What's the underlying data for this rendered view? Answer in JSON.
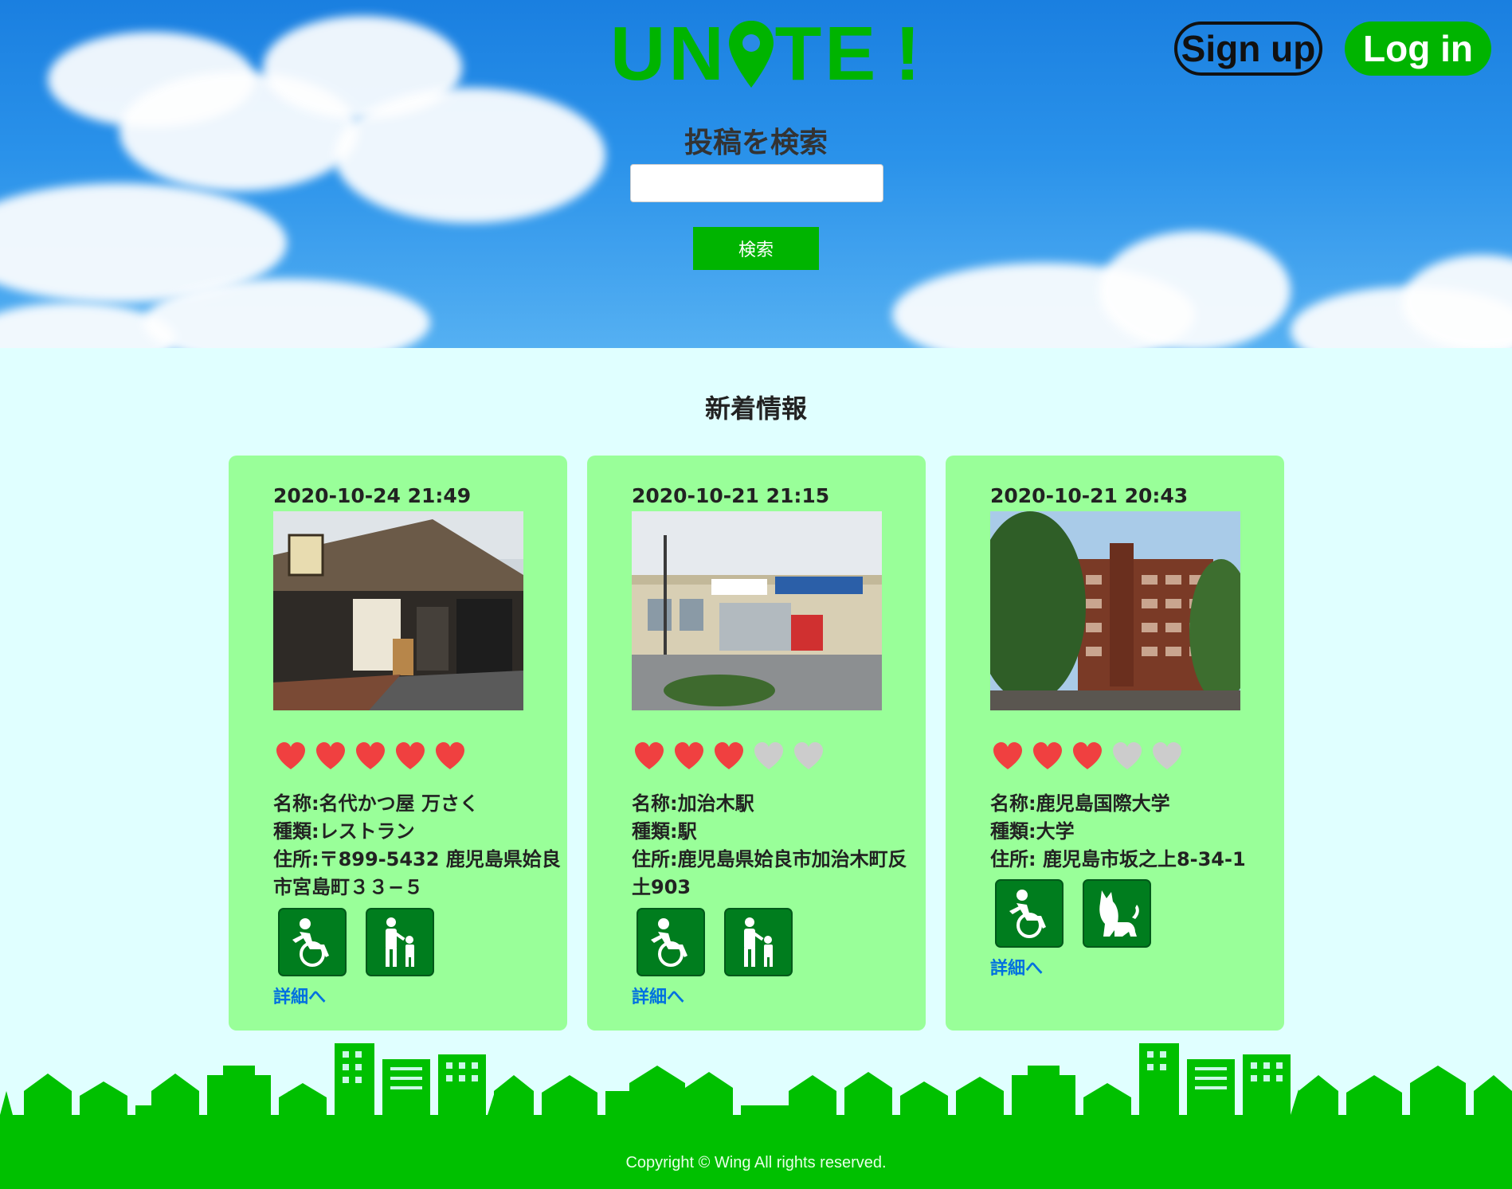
{
  "header": {
    "logo": {
      "text_left": "UN",
      "text_right": "TE",
      "exclaim": "!"
    },
    "signup_label": "Sign up",
    "login_label": "Log in",
    "search_title": "投稿を検索",
    "search_value": "",
    "search_button": "検索"
  },
  "news": {
    "title": "新着情報",
    "cards": [
      {
        "date": "2020-10-24 21:49",
        "rating": 5,
        "name": "名称:名代かつ屋 万さく",
        "type": "種類:レストラン",
        "address": "住所:〒899-5432 鹿児島県姶良市宮島町３３−５",
        "badges": [
          "wheelchair-icon",
          "parent-child-icon"
        ],
        "detail_label": "詳細へ"
      },
      {
        "date": "2020-10-21 21:15",
        "rating": 3,
        "name": "名称:加治木駅",
        "type": "種類:駅",
        "address": "住所:鹿児島県姶良市加治木町反土903",
        "badges": [
          "wheelchair-icon",
          "parent-child-icon"
        ],
        "detail_label": "詳細へ"
      },
      {
        "date": "2020-10-21 20:43",
        "rating": 3,
        "name": "名称:鹿児島国際大学",
        "type": "種類:大学",
        "address": "住所: 鹿児島市坂之上8-34-1",
        "badges": [
          "wheelchair-icon",
          "dog-icon"
        ],
        "detail_label": "詳細へ"
      }
    ]
  },
  "footer": {
    "copyright": "Copyright © Wing All rights reserved."
  },
  "colors": {
    "brand_green": "#00b400",
    "card_bg": "#99ff99",
    "page_bg": "#e0ffff",
    "heart_on": "#f04040",
    "heart_off": "#cccccc",
    "badge_bg": "#007d1e",
    "link": "#0070e0"
  }
}
